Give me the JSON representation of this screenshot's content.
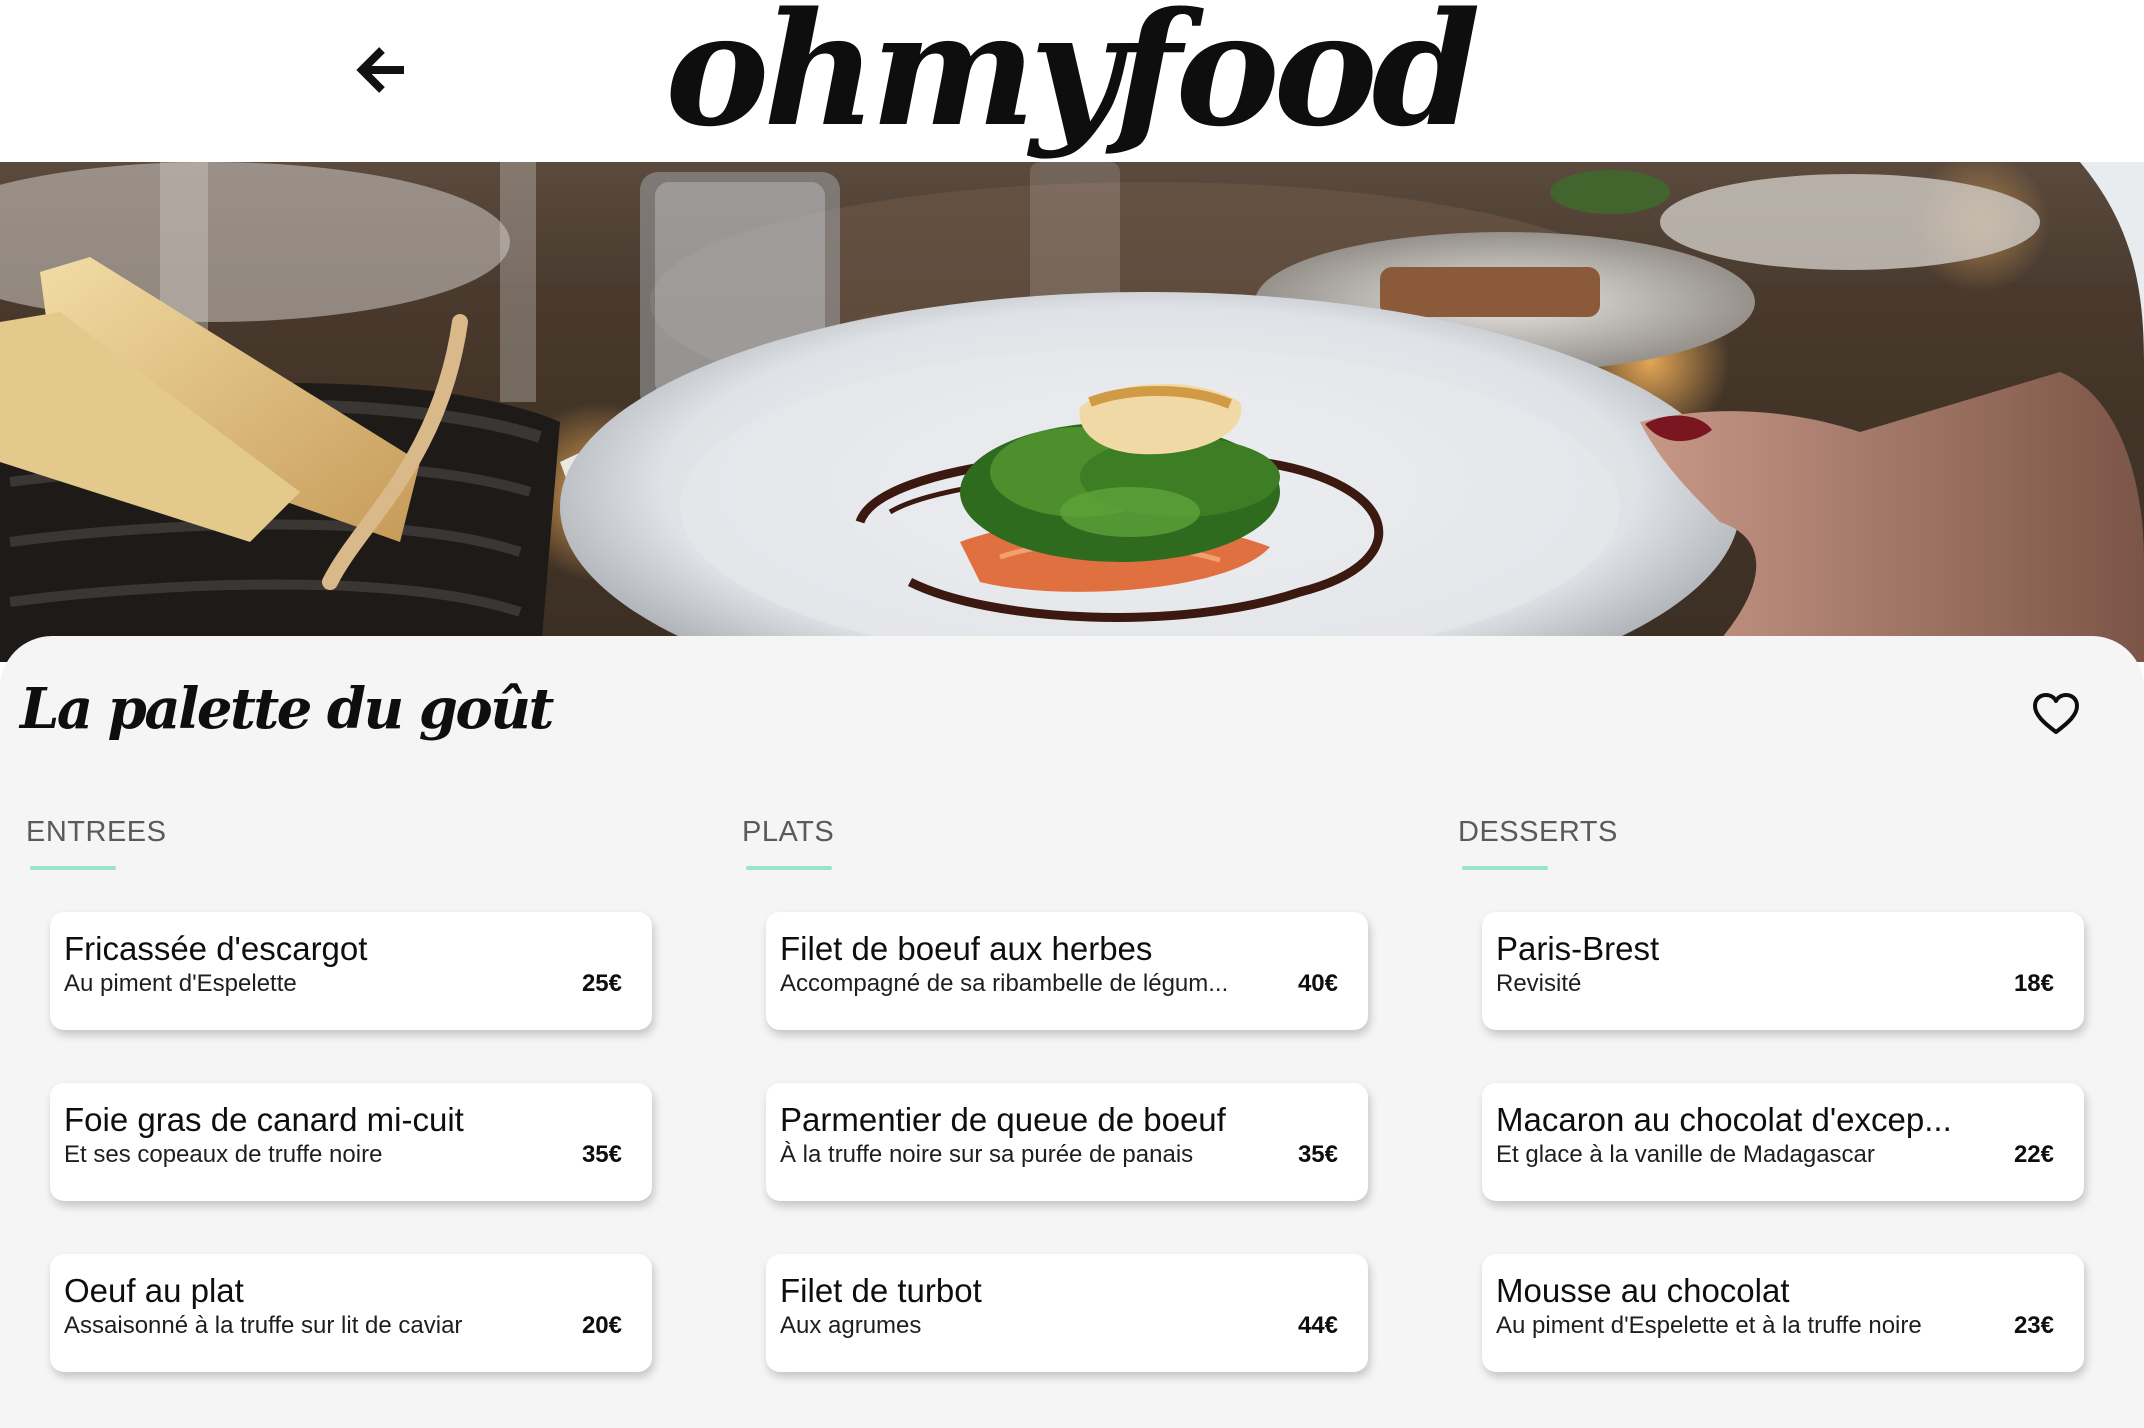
{
  "header": {
    "back_icon": "arrow-left-icon",
    "logo_text": "ohmyfood"
  },
  "hero": {
    "image_alt": ""
  },
  "restaurant": {
    "name": "La palette du goût",
    "favorite_icon": "heart-outline-icon"
  },
  "colors": {
    "accent": "#99e2d0",
    "panel_background": "#f5f5f5",
    "text": "#0e0e0e"
  },
  "menu": {
    "columns": [
      {
        "heading": "ENTREES",
        "items": [
          {
            "name": "Fricassée d'escargot",
            "description": "Au piment d'Espelette",
            "price": "25€"
          },
          {
            "name": "Foie gras de canard mi-cuit",
            "description": "Et ses copeaux de truffe noire",
            "price": "35€"
          },
          {
            "name": "Oeuf au plat",
            "description": "Assaisonné à la truffe sur lit de caviar",
            "price": "20€"
          }
        ]
      },
      {
        "heading": "PLATS",
        "items": [
          {
            "name": "Filet de boeuf aux herbes",
            "description": "Accompagné de sa ribambelle de légum...",
            "price": "40€"
          },
          {
            "name": "Parmentier de queue de boeuf",
            "description": "À la truffe noire sur sa purée de panais",
            "price": "35€"
          },
          {
            "name": "Filet de turbot",
            "description": "Aux agrumes",
            "price": "44€"
          }
        ]
      },
      {
        "heading": "DESSERTS",
        "items": [
          {
            "name": "Paris-Brest",
            "description": "Revisité",
            "price": "18€"
          },
          {
            "name": "Macaron au chocolat d'excep...",
            "description": "Et glace à la vanille de Madagascar",
            "price": "22€"
          },
          {
            "name": "Mousse au chocolat",
            "description": "Au piment d'Espelette et à la truffe noire",
            "price": "23€"
          }
        ]
      }
    ]
  }
}
